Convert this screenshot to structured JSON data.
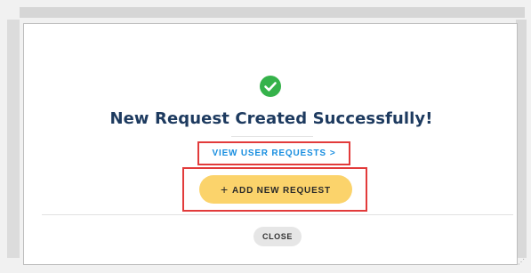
{
  "modal": {
    "title": "New Request Created Successfully!",
    "view_requests_label": "VIEW USER REQUESTS",
    "view_requests_chevron": ">",
    "add_request_plus": "+",
    "add_request_label": "ADD NEW REQUEST",
    "close_label": "CLOSE"
  },
  "icons": {
    "success": "check-circle-icon",
    "chevron": "chevron-right-icon",
    "plus": "plus-icon"
  },
  "colors": {
    "title": "#1d3a5f",
    "link": "#1a8fe0",
    "primary_button": "#fbd36b",
    "success": "#35b24a",
    "highlight_box": "#e23b3b",
    "close_button": "#e6e6e6"
  }
}
